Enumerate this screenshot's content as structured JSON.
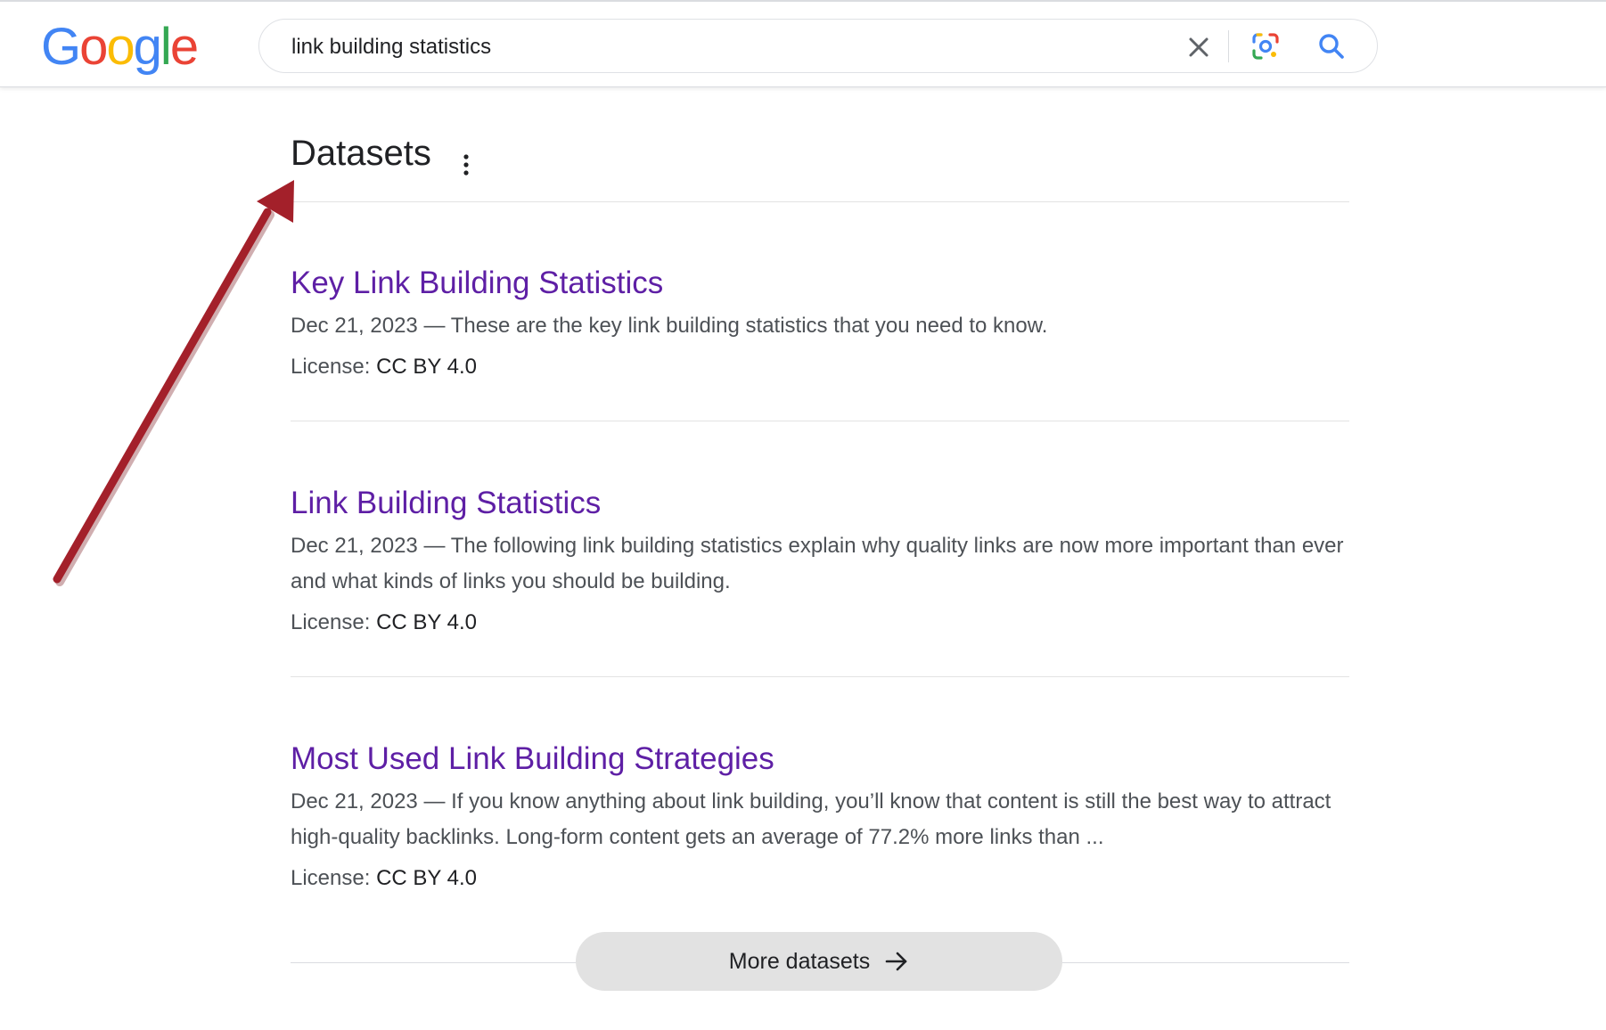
{
  "header": {
    "logo_letters": [
      {
        "ch": "G",
        "color": "#4285F4"
      },
      {
        "ch": "o",
        "color": "#EA4335"
      },
      {
        "ch": "o",
        "color": "#FBBC05"
      },
      {
        "ch": "g",
        "color": "#4285F4"
      },
      {
        "ch": "l",
        "color": "#34A853"
      },
      {
        "ch": "e",
        "color": "#EA4335"
      }
    ],
    "search_query": "link building statistics",
    "icons": {
      "clear": "close-icon",
      "lens": "camera-lens-icon",
      "search": "search-icon"
    }
  },
  "section": {
    "title": "Datasets",
    "menu_icon": "more-vert-icon"
  },
  "results": [
    {
      "title": "Key Link Building Statistics",
      "date": "Dec 21, 2023",
      "snippet": "These are the key link building statistics that you need to know.",
      "license_label": "License:",
      "license_value": "CC BY 4.0"
    },
    {
      "title": "Link Building Statistics",
      "date": "Dec 21, 2023",
      "snippet": "The following link building statistics explain why quality links are now more important than ever and what kinds of links you should be building.",
      "license_label": "License:",
      "license_value": "CC BY 4.0"
    },
    {
      "title": "Most Used Link Building Strategies",
      "date": "Dec 21, 2023",
      "snippet": "If you know anything about link building, you’ll know that content is still the best way to attract high-quality backlinks. Long-form content gets an average of 77.2% more links than ...",
      "license_label": "License:",
      "license_value": "CC BY 4.0"
    }
  ],
  "more_button": {
    "label": "More datasets",
    "icon": "arrow-right-icon"
  },
  "annotation": {
    "color": "#a3202a",
    "icon": "annotation-arrow-icon"
  },
  "colors": {
    "link": "#5e1fa5",
    "snippet": "#4d5156",
    "text": "#202124"
  }
}
